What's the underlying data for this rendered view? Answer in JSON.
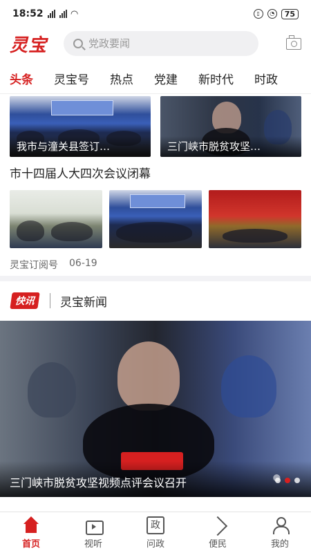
{
  "status_bar": {
    "time": "18:52",
    "network_left": "4G",
    "network_right": "4G",
    "battery": "75"
  },
  "header": {
    "logo_text": "灵宝",
    "search_placeholder": "党政要闻",
    "camera_icon": "camera-icon"
  },
  "tabs": [
    {
      "label": "头条",
      "active": true
    },
    {
      "label": "灵宝号",
      "active": false
    },
    {
      "label": "热点",
      "active": false
    },
    {
      "label": "党建",
      "active": false
    },
    {
      "label": "新时代",
      "active": false
    },
    {
      "label": "时政",
      "active": false
    }
  ],
  "top_row": [
    {
      "caption": "我市与潼关县签订…"
    },
    {
      "caption": "三门峡市脱贫攻坚…"
    }
  ],
  "article": {
    "title": "市十四届人大四次会议闭幕",
    "source": "灵宝订阅号",
    "date": "06-19"
  },
  "flash": {
    "badge": "快讯",
    "title": "灵宝新闻"
  },
  "hero": {
    "caption": "三门峡市脱贫攻坚视频点评会议召开",
    "slides": 4,
    "active_slide": 2
  },
  "bottom_nav": [
    {
      "label": "首页",
      "icon": "home-icon",
      "active": true
    },
    {
      "label": "视听",
      "icon": "tv-icon",
      "active": false
    },
    {
      "label": "问政",
      "icon": "zheng-icon",
      "glyph": "政",
      "active": false
    },
    {
      "label": "便民",
      "icon": "send-icon",
      "active": false
    },
    {
      "label": "我的",
      "icon": "user-icon",
      "active": false
    }
  ],
  "colors": {
    "accent": "#d62020",
    "text": "#222222",
    "muted": "#666666"
  }
}
